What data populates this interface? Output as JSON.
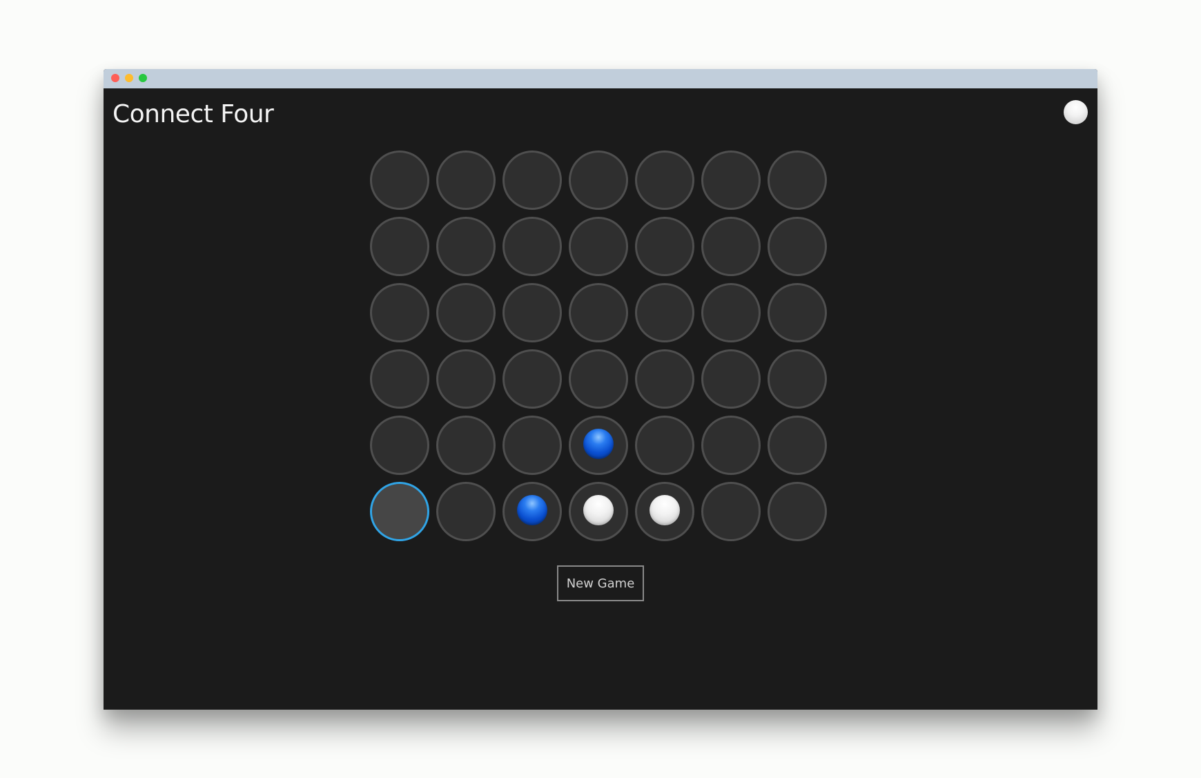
{
  "window": {
    "title_buttons": [
      {
        "name": "close",
        "color": "#fe5f57"
      },
      {
        "name": "minimize",
        "color": "#febc2e"
      },
      {
        "name": "maximize",
        "color": "#28c840"
      }
    ]
  },
  "app": {
    "title": "Connect Four"
  },
  "turn_indicator": {
    "player": "white"
  },
  "colors": {
    "board_background": "#1b1b1b",
    "cell_fill": "#2f2f2f",
    "cell_border": "#4f4f4f",
    "selected_border": "#30a4e6",
    "blue_piece": "#0a4fd0",
    "white_piece": "#f2f2f2"
  },
  "board": {
    "columns": 7,
    "rows": 6,
    "selected_cell": {
      "row": 5,
      "col": 0
    },
    "cells": [
      [
        null,
        null,
        null,
        null,
        null,
        null,
        null
      ],
      [
        null,
        null,
        null,
        null,
        null,
        null,
        null
      ],
      [
        null,
        null,
        null,
        null,
        null,
        null,
        null
      ],
      [
        null,
        null,
        null,
        null,
        null,
        null,
        null
      ],
      [
        null,
        null,
        null,
        "blue",
        null,
        null,
        null
      ],
      [
        null,
        null,
        "blue",
        "white",
        "white",
        null,
        null
      ]
    ]
  },
  "controls": {
    "new_game_label": "New Game"
  }
}
